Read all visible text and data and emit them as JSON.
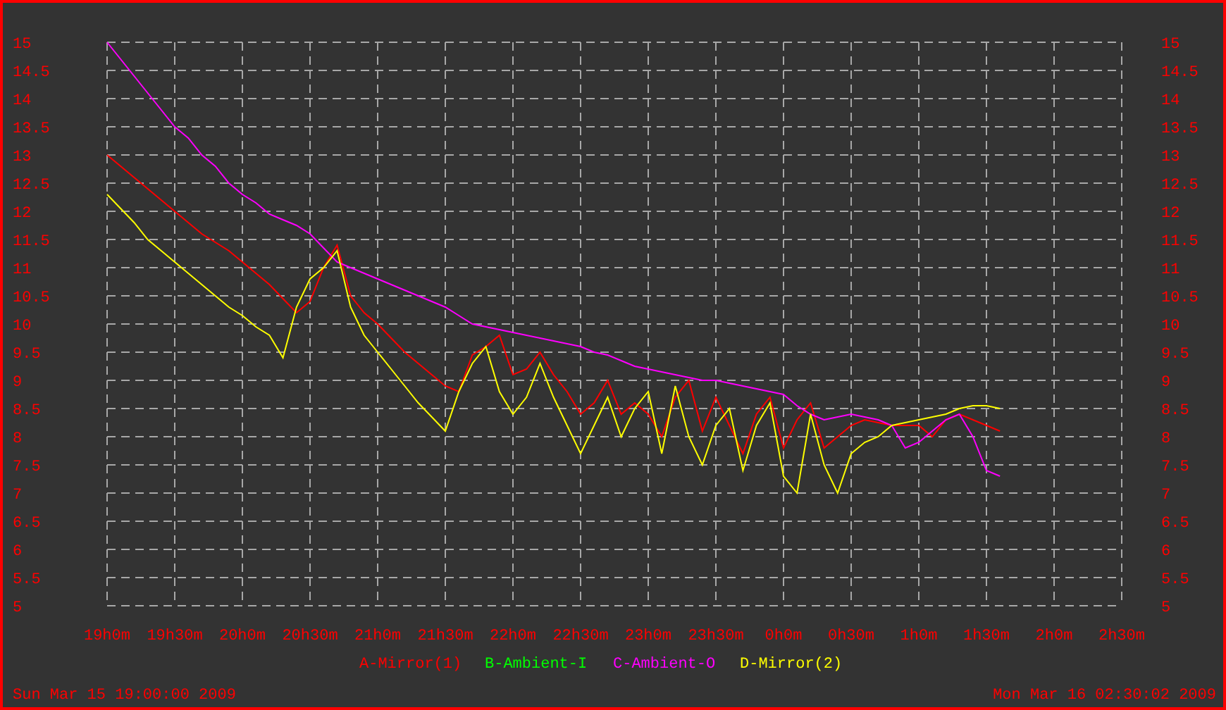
{
  "chart_data": {
    "type": "line",
    "grid": true,
    "categories": [
      "19h0m",
      null,
      null,
      null,
      null,
      "19h30m",
      null,
      null,
      null,
      null,
      "20h0m",
      null,
      null,
      null,
      null,
      "20h30m",
      null,
      null,
      null,
      null,
      "21h0m",
      null,
      null,
      null,
      null,
      "21h30m",
      null,
      null,
      null,
      null,
      "22h0m",
      null,
      null,
      null,
      null,
      "22h30m",
      null,
      null,
      null,
      null,
      "23h0m",
      null,
      null,
      null,
      null,
      "23h30m",
      null,
      null,
      null,
      null,
      "0h0m",
      null,
      null,
      null,
      null,
      "0h30m",
      null,
      null,
      null,
      null,
      "1h0m",
      null,
      null,
      null,
      null,
      "1h30m",
      null,
      null,
      null,
      null,
      "2h0m",
      null,
      null,
      null,
      null,
      "2h30m"
    ],
    "series": [
      {
        "name": "A-Mirror(1)",
        "color": "#ff0000",
        "values": [
          13,
          12.8,
          12.6,
          12.4,
          12.2,
          12,
          11.8,
          11.6,
          11.45,
          11.3,
          11.1,
          10.9,
          10.7,
          10.45,
          10.2,
          10.4,
          11,
          11.4,
          10.5,
          10.2,
          10,
          9.75,
          9.5,
          9.3,
          9.1,
          8.9,
          8.8,
          9.45,
          9.6,
          9.8,
          9.1,
          9.2,
          9.5,
          9.1,
          8.8,
          8.4,
          8.6,
          9,
          8.4,
          8.6,
          8.4,
          8,
          8.7,
          9,
          8.1,
          8.7,
          8.2,
          7.7,
          8.4,
          8.7,
          7.8,
          8.3,
          8.6,
          7.8,
          8,
          8.2,
          8.3,
          8.25,
          8.2,
          8.2,
          8.2,
          8,
          8.3,
          8.4,
          8.3,
          8.2,
          8.1,
          null,
          null,
          null,
          null,
          null,
          null,
          null,
          null,
          null
        ]
      },
      {
        "name": "B-Ambient-I",
        "color": "#00ff00",
        "values": [
          null,
          null,
          null,
          null,
          null,
          null,
          null,
          null,
          null,
          null,
          null,
          null,
          null,
          null,
          null,
          null,
          null,
          null,
          null,
          null,
          null,
          null,
          null,
          null,
          null,
          null,
          null,
          null,
          null,
          null,
          null,
          null,
          null,
          null,
          null,
          null,
          null,
          null,
          null,
          null,
          null,
          null,
          null,
          null,
          null,
          null,
          null,
          null,
          null,
          null,
          null,
          null,
          null,
          null,
          null,
          null,
          null,
          null,
          null,
          null,
          null,
          null,
          null,
          null,
          null,
          null,
          null,
          null,
          null,
          null,
          null,
          null,
          null,
          null,
          null,
          null
        ]
      },
      {
        "name": "C-Ambient-O",
        "color": "#ff00ff",
        "values": [
          15,
          14.7,
          14.4,
          14.1,
          13.8,
          13.5,
          13.3,
          13,
          12.8,
          12.5,
          12.3,
          12.15,
          11.95,
          11.85,
          11.75,
          11.6,
          11.35,
          11.1,
          11,
          10.9,
          10.8,
          10.7,
          10.6,
          10.5,
          10.4,
          10.3,
          10.15,
          10,
          9.95,
          9.9,
          9.85,
          9.8,
          9.75,
          9.7,
          9.65,
          9.6,
          9.5,
          9.45,
          9.35,
          9.25,
          9.2,
          9.15,
          9.1,
          9.05,
          9,
          9,
          8.95,
          8.9,
          8.85,
          8.8,
          8.75,
          8.55,
          8.4,
          8.3,
          8.35,
          8.4,
          8.35,
          8.3,
          8.2,
          7.8,
          7.9,
          8.1,
          8.3,
          8.4,
          8,
          7.4,
          7.3,
          null,
          null,
          null,
          null,
          null,
          null,
          null,
          null,
          null
        ]
      },
      {
        "name": "D-Mirror(2)",
        "color": "#ffff00",
        "values": [
          12.3,
          12.05,
          11.8,
          11.5,
          11.3,
          11.1,
          10.9,
          10.7,
          10.5,
          10.3,
          10.15,
          9.95,
          9.8,
          9.4,
          10.3,
          10.8,
          11,
          11.3,
          10.3,
          9.8,
          9.5,
          9.2,
          8.9,
          8.6,
          8.35,
          8.1,
          8.8,
          9.3,
          9.6,
          8.8,
          8.4,
          8.7,
          9.3,
          8.7,
          8.2,
          7.7,
          8.2,
          8.7,
          8,
          8.5,
          8.8,
          7.7,
          8.9,
          8,
          7.5,
          8.2,
          8.5,
          7.4,
          8.2,
          8.6,
          7.3,
          7,
          8.4,
          7.5,
          7,
          7.7,
          7.9,
          8,
          8.2,
          8.25,
          8.3,
          8.35,
          8.4,
          8.5,
          8.55,
          8.55,
          8.5,
          null,
          null,
          null,
          null,
          null,
          null,
          null,
          null,
          null
        ]
      }
    ],
    "ylim": [
      5,
      15
    ],
    "yticks": [
      15,
      14.5,
      14,
      13.5,
      13,
      12.5,
      12,
      11.5,
      11,
      10.5,
      10,
      9.5,
      9,
      8.5,
      8,
      7.5,
      7,
      6.5,
      6,
      5.5,
      5
    ]
  },
  "left_axis": {
    "labels": [
      "15",
      "14.5",
      "14",
      "13.5",
      "13",
      "12.5",
      "12",
      "11.5",
      "11",
      "10.5",
      "10",
      "9.5",
      "9",
      "8.5",
      "8",
      "7.5",
      "7",
      "6.5",
      "6",
      "5.5",
      "5"
    ]
  },
  "right_axis": {
    "labels": [
      "15",
      "14.5",
      "14",
      "13.5",
      "13",
      "12.5",
      "12",
      "11.5",
      "11",
      "10.5",
      "10",
      "9.5",
      "9",
      "8.5",
      "8",
      "7.5",
      "7",
      "6.5",
      "6",
      "5.5",
      "5"
    ]
  },
  "footer": {
    "start_time": "Sun Mar 15 19:00:00 2009",
    "end_time": "Mon Mar 16 02:30:02 2009"
  }
}
